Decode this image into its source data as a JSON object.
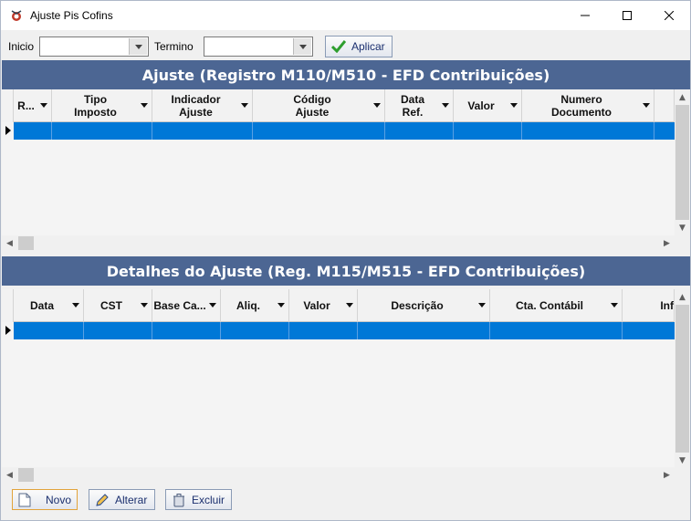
{
  "window": {
    "title": "Ajuste Pis Cofins",
    "min_glyph": "—",
    "max_glyph": "☐",
    "close_glyph": "✕"
  },
  "filter": {
    "inicio_label": "Inicio",
    "inicio_value": "",
    "termino_label": "Termino",
    "termino_value": "",
    "aplicar_label": "Aplicar"
  },
  "ajuste": {
    "title": "Ajuste (Registro M110/M510 - EFD Contribuições)",
    "columns": [
      {
        "line1": "R...",
        "line2": ""
      },
      {
        "line1": "Tipo",
        "line2": "Imposto"
      },
      {
        "line1": "Indicador",
        "line2": "Ajuste"
      },
      {
        "line1": "Código",
        "line2": "Ajuste"
      },
      {
        "line1": "Data",
        "line2": "Ref."
      },
      {
        "line1": "Valor",
        "line2": ""
      },
      {
        "line1": "Numero",
        "line2": "Documento"
      }
    ]
  },
  "detalhes": {
    "title": "Detalhes do Ajuste (Reg. M115/M515 - EFD Contribuições)",
    "columns": [
      {
        "line1": "Data"
      },
      {
        "line1": "CST"
      },
      {
        "line1": "Base Ca..."
      },
      {
        "line1": "Aliq."
      },
      {
        "line1": "Valor"
      },
      {
        "line1": "Descrição"
      },
      {
        "line1": "Cta. Contábil"
      },
      {
        "line1": "Inf"
      }
    ]
  },
  "actions": {
    "novo_label": "Novo",
    "alterar_label": "Alterar",
    "excluir_label": "Excluir"
  },
  "colors": {
    "header_bg": "#4c6693",
    "selection": "#0078d7"
  }
}
